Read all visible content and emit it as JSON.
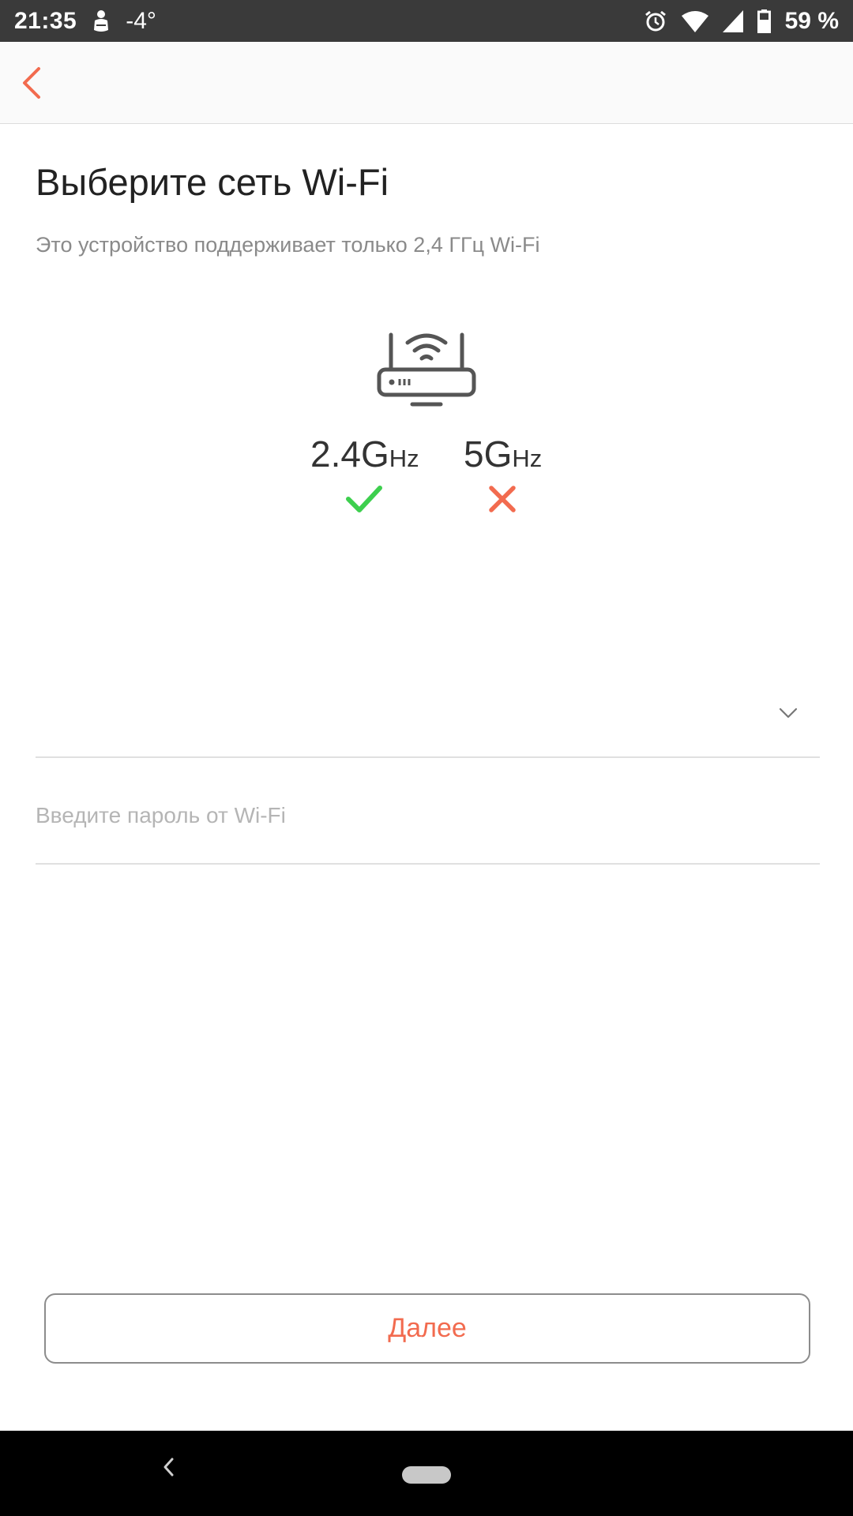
{
  "status_bar": {
    "time": "21:35",
    "temperature": "-4°",
    "battery": "59 %",
    "icons": [
      "weather-icon",
      "alarm-icon",
      "wifi-icon",
      "signal-icon",
      "battery-icon"
    ]
  },
  "app_bar": {
    "back_icon": "chevron-left-icon",
    "accent_color": "#f26b4f"
  },
  "main": {
    "title": "Выберите сеть Wi-Fi",
    "subtitle": "Это устройство поддерживает только 2,4 ГГц Wi-Fi",
    "router_icon": "router-icon",
    "bands": [
      {
        "number": "2.4G",
        "unit": "Hz",
        "supported": true,
        "status_icon": "check-icon",
        "color": "#3dcf4e"
      },
      {
        "number": "5G",
        "unit": "Hz",
        "supported": false,
        "status_icon": "close-icon",
        "color": "#f26b4f"
      }
    ],
    "network_select": {
      "value": "",
      "icon": "chevron-down-icon"
    },
    "password": {
      "value": "",
      "placeholder": "Введите пароль от Wi-Fi"
    },
    "next_label": "Далее"
  },
  "nav_bar": {
    "back_icon": "nav-back-icon",
    "home_icon": "home-pill-icon"
  }
}
